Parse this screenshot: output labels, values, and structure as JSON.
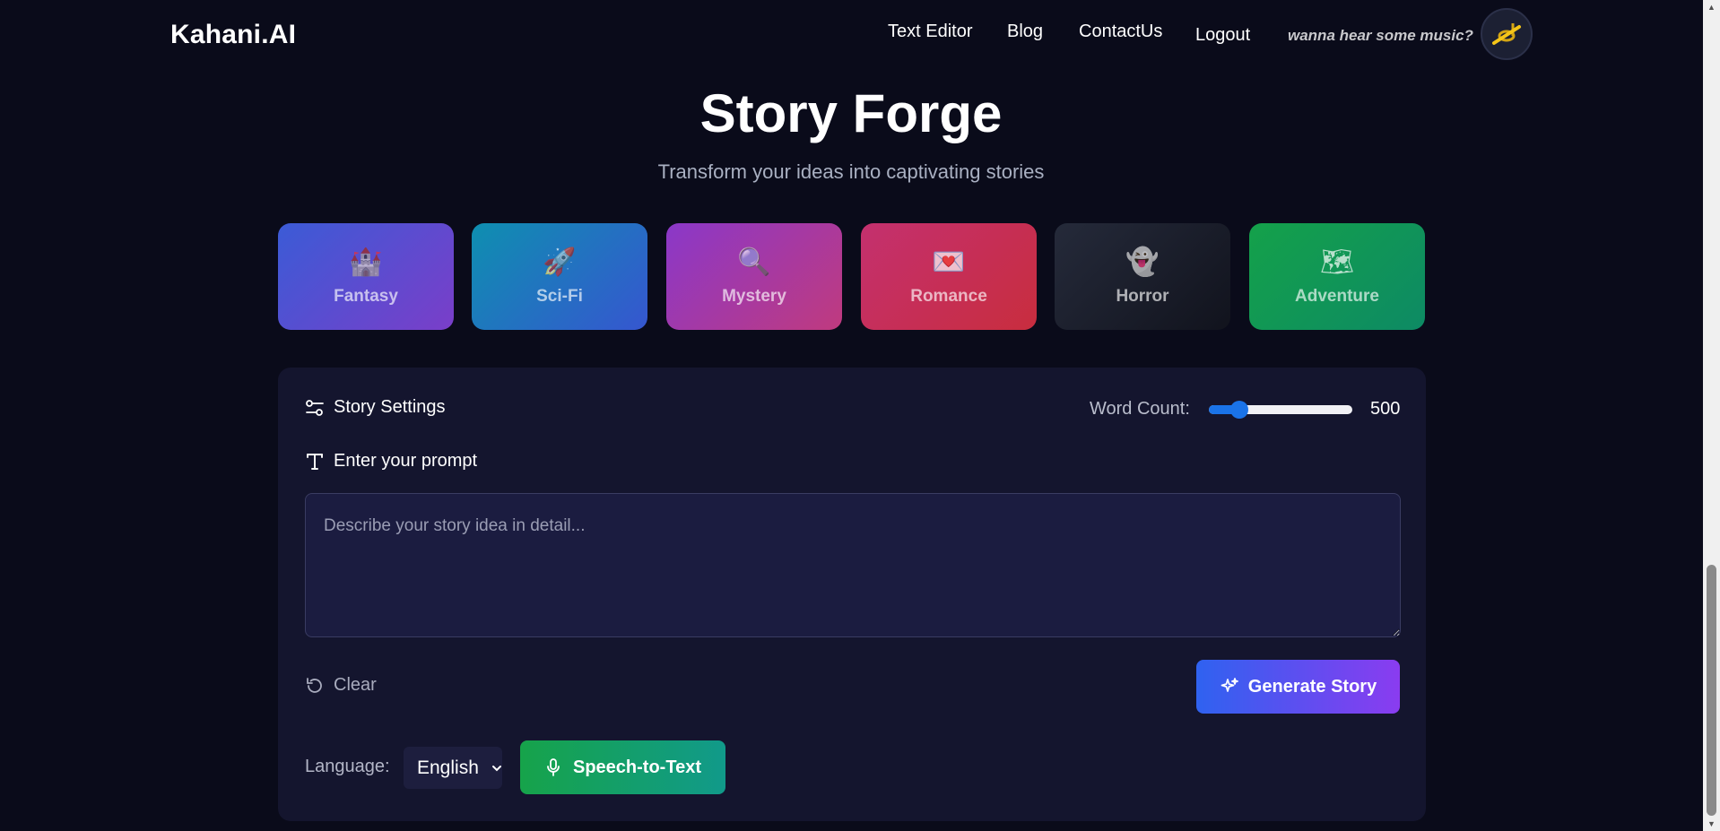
{
  "header": {
    "logo": "Kahani.AI",
    "nav": [
      {
        "label": "Text Editor"
      },
      {
        "label": "Blog"
      },
      {
        "label": "ContactUs"
      },
      {
        "label": "Logout"
      }
    ],
    "music_prompt": "wanna hear some music?",
    "music_icon": "music-off-icon"
  },
  "hero": {
    "title": "Story Forge",
    "subtitle": "Transform your ideas into captivating stories"
  },
  "genres": [
    {
      "label": "Fantasy",
      "icon": "🏰",
      "icon_name": "castle-icon",
      "colors": [
        "#3b5bd6",
        "#7a3ec9"
      ]
    },
    {
      "label": "Sci-Fi",
      "icon": "🚀",
      "icon_name": "rocket-icon",
      "colors": [
        "#0e8fb0",
        "#3656d0"
      ]
    },
    {
      "label": "Mystery",
      "icon": "🔍",
      "icon_name": "magnifier-icon",
      "colors": [
        "#8a38c9",
        "#c03a7e"
      ]
    },
    {
      "label": "Romance",
      "icon": "💌",
      "icon_name": "love-letter-icon",
      "colors": [
        "#c4306f",
        "#c82d3e"
      ]
    },
    {
      "label": "Horror",
      "icon": "👻",
      "icon_name": "ghost-icon",
      "colors": [
        "#252a3a",
        "#11131d"
      ]
    },
    {
      "label": "Adventure",
      "icon": "🗺",
      "icon_name": "map-icon",
      "colors": [
        "#14a14a",
        "#0d8a64"
      ]
    }
  ],
  "settings": {
    "title": "Story Settings",
    "word_count_label": "Word Count:",
    "word_count_value": "500",
    "word_count_min": 100,
    "word_count_max": 2000,
    "prompt_label": "Enter your prompt",
    "prompt_placeholder": "Describe your story idea in detail...",
    "prompt_value": "",
    "clear_label": "Clear",
    "generate_label": "Generate Story",
    "language_label": "Language:",
    "language_value": "English",
    "speech_label": "Speech-to-Text"
  },
  "colors": {
    "background": "#0a0b1a",
    "panel": "#14152e",
    "slider_accent": "#1a73e8"
  }
}
